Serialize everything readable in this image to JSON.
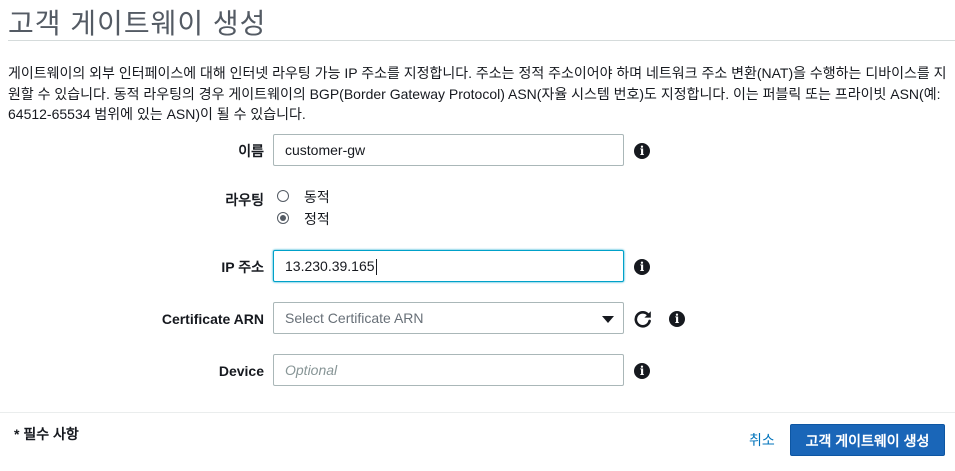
{
  "page": {
    "title": "고객 게이트웨이 생성",
    "description": "게이트웨이의 외부 인터페이스에 대해 인터넷 라우팅 가능 IP 주소를 지정합니다. 주소는 정적 주소이어야 하며 네트워크 주소 변환(NAT)을 수행하는 디바이스를 지원할 수 있습니다. 동적 라우팅의 경우 게이트웨이의 BGP(Border Gateway Protocol) ASN(자율 시스템 번호)도 지정합니다. 이는 퍼블릭 또는 프라이빗 ASN(예: 64512-65534 범위에 있는 ASN)이 될 수 있습니다."
  },
  "form": {
    "name": {
      "label": "이름",
      "value": "customer-gw"
    },
    "routing": {
      "label": "라우팅",
      "options": [
        {
          "label": "동적",
          "checked": false
        },
        {
          "label": "정적",
          "checked": true
        }
      ]
    },
    "ip": {
      "label": "IP 주소",
      "value": "13.230.39.165"
    },
    "certificate": {
      "label": "Certificate ARN",
      "selected": "Select Certificate ARN"
    },
    "device": {
      "label": "Device",
      "placeholder": "Optional"
    }
  },
  "footer": {
    "required_note": "* 필수 사항",
    "cancel_label": "취소",
    "create_label": "고객 게이트웨이 생성"
  },
  "colors": {
    "primary_button": "#1a66b8",
    "link": "#0073bb",
    "focus_border": "#00a1c9"
  },
  "icons": [
    "info-icon",
    "refresh-icon",
    "chevron-down-icon",
    "radio-button-icon"
  ]
}
